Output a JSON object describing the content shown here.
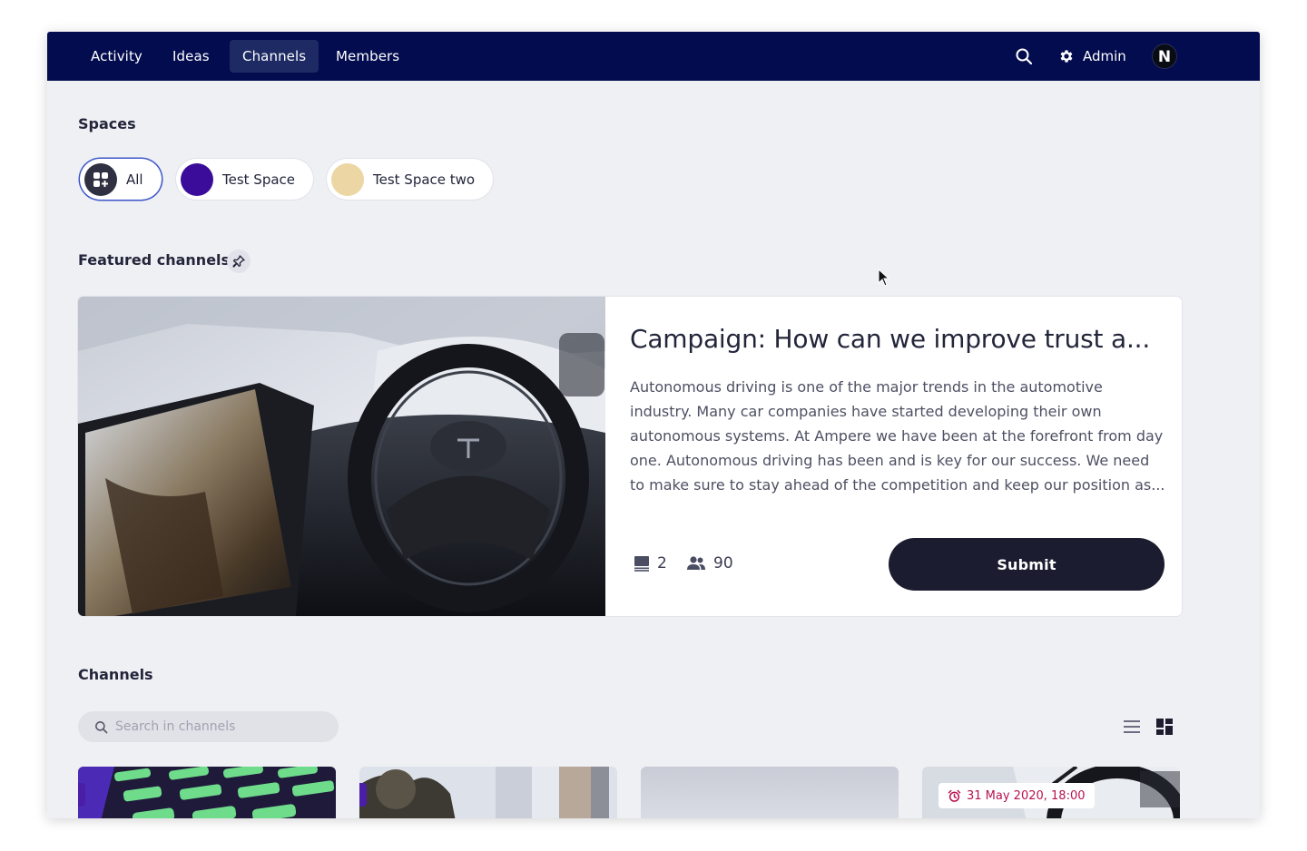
{
  "nav": {
    "items": [
      {
        "label": "Activity",
        "active": false
      },
      {
        "label": "Ideas",
        "active": false
      },
      {
        "label": "Channels",
        "active": true
      },
      {
        "label": "Members",
        "active": false
      }
    ],
    "admin_label": "Admin",
    "avatar_letter": "N",
    "background_color": "#030c4f"
  },
  "spaces": {
    "title": "Spaces",
    "chips": [
      {
        "label": "All",
        "active": true,
        "color": "#2f3142"
      },
      {
        "label": "Test Space",
        "active": false,
        "color": "#3b0c99"
      },
      {
        "label": "Test Space two",
        "active": false,
        "color": "#ecd7a4"
      }
    ]
  },
  "featured": {
    "title": "Featured channels",
    "card": {
      "title": "Campaign: How can we improve trust a...",
      "description": "Autonomous driving is one of the major trends in the automotive industry. Many car companies have started developing their own autonomous systems. At Ampere we have been at the forefront from day one. Autonomous driving has been and is key for our success. We need to make sure to stay ahead of the competition and keep our position as...",
      "ideas_count": "2",
      "members_count": "90",
      "submit_label": "Submit"
    }
  },
  "channels": {
    "title": "Channels",
    "search_placeholder": "Search in channels",
    "cards": [
      {
        "date": ""
      },
      {
        "date": ""
      },
      {
        "date": ""
      },
      {
        "date": "31 May 2020, 18:00"
      }
    ]
  }
}
